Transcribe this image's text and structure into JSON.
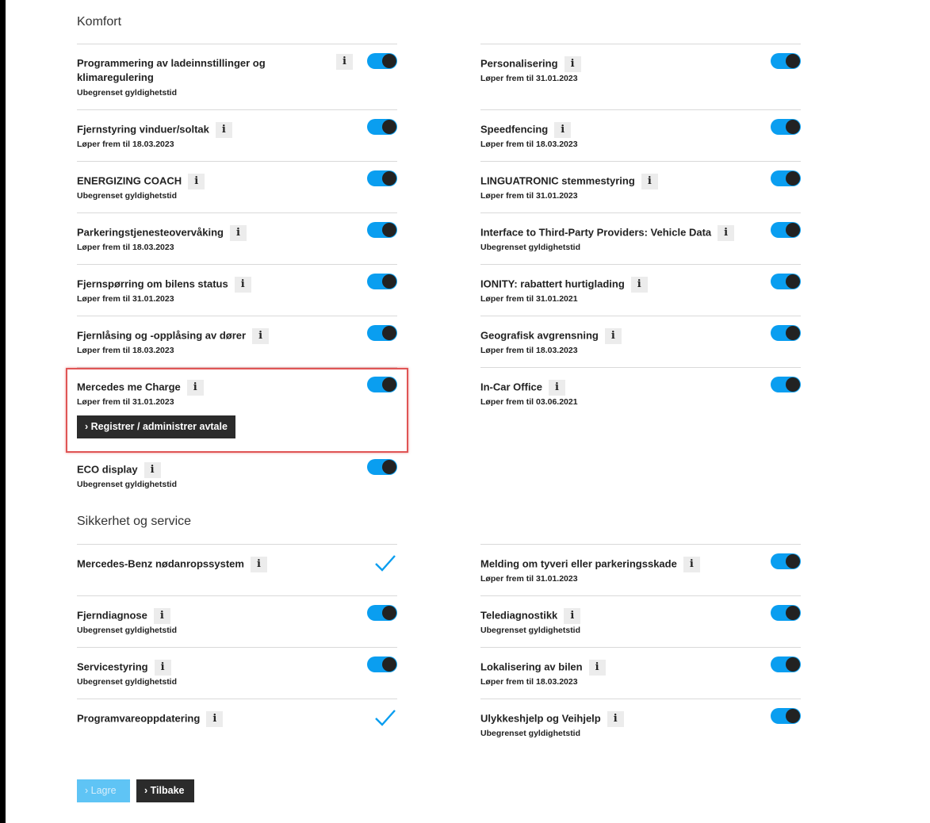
{
  "sections": {
    "komfort": "Komfort",
    "sikkerhet": "Sikkerhet og service"
  },
  "info_icon": "i",
  "komfort_left": [
    {
      "title": "Programmering av ladeinnstillinger og klimaregulering",
      "sub": "Ubegrenset gyldighetstid"
    },
    {
      "title": "Fjernstyring vinduer/soltak",
      "sub": "Løper frem til 18.03.2023"
    },
    {
      "title": "ENERGIZING COACH",
      "sub": "Ubegrenset gyldighetstid"
    },
    {
      "title": "Parkeringstjenesteovervåking",
      "sub": "Løper frem til 18.03.2023"
    },
    {
      "title": "Fjernspørring om bilens status",
      "sub": "Løper frem til 31.01.2023"
    },
    {
      "title": "Fjernlåsing og -opplåsing av dører",
      "sub": "Løper frem til 18.03.2023"
    },
    {
      "title": "Mercedes me Charge",
      "sub": "Løper frem til 31.01.2023",
      "action": "Registrer / administrer avtale"
    },
    {
      "title": "ECO display",
      "sub": "Ubegrenset gyldighetstid"
    }
  ],
  "komfort_right": [
    {
      "title": "Personalisering",
      "sub": "Løper frem til 31.01.2023"
    },
    {
      "title": "Speedfencing",
      "sub": "Løper frem til 18.03.2023"
    },
    {
      "title": "LINGUATRONIC stemmestyring",
      "sub": "Løper frem til 31.01.2023"
    },
    {
      "title": "Interface to Third-Party Providers: Vehicle Data",
      "sub": "Ubegrenset gyldighetstid"
    },
    {
      "title": "IONITY: rabattert hurtiglading",
      "sub": "Løper frem til 31.01.2021"
    },
    {
      "title": "Geografisk avgrensning",
      "sub": "Løper frem til 18.03.2023"
    },
    {
      "title": "In-Car Office",
      "sub": "Løper frem til 03.06.2021"
    }
  ],
  "sikkerhet_left": [
    {
      "title": "Mercedes-Benz nødanropssystem",
      "sub": "",
      "control": "check"
    },
    {
      "title": "Fjerndiagnose",
      "sub": "Ubegrenset gyldighetstid",
      "control": "toggle"
    },
    {
      "title": "Servicestyring",
      "sub": "Ubegrenset gyldighetstid",
      "control": "toggle"
    },
    {
      "title": "Programvareoppdatering",
      "sub": "",
      "control": "check"
    }
  ],
  "sikkerhet_right": [
    {
      "title": "Melding om tyveri eller parkeringsskade",
      "sub": "Løper frem til 31.01.2023"
    },
    {
      "title": "Telediagnostikk",
      "sub": "Ubegrenset gyldighetstid"
    },
    {
      "title": "Lokalisering av bilen",
      "sub": "Løper frem til 18.03.2023"
    },
    {
      "title": "Ulykkeshjelp og Veihjelp",
      "sub": "Ubegrenset gyldighetstid"
    }
  ],
  "footer": {
    "save_label": "› Lagre",
    "back_label": "› Tilbake"
  },
  "colors": {
    "toggle_on": "#0a9ef0",
    "highlight": "#e05555",
    "button_dark": "#2b2b2b"
  }
}
